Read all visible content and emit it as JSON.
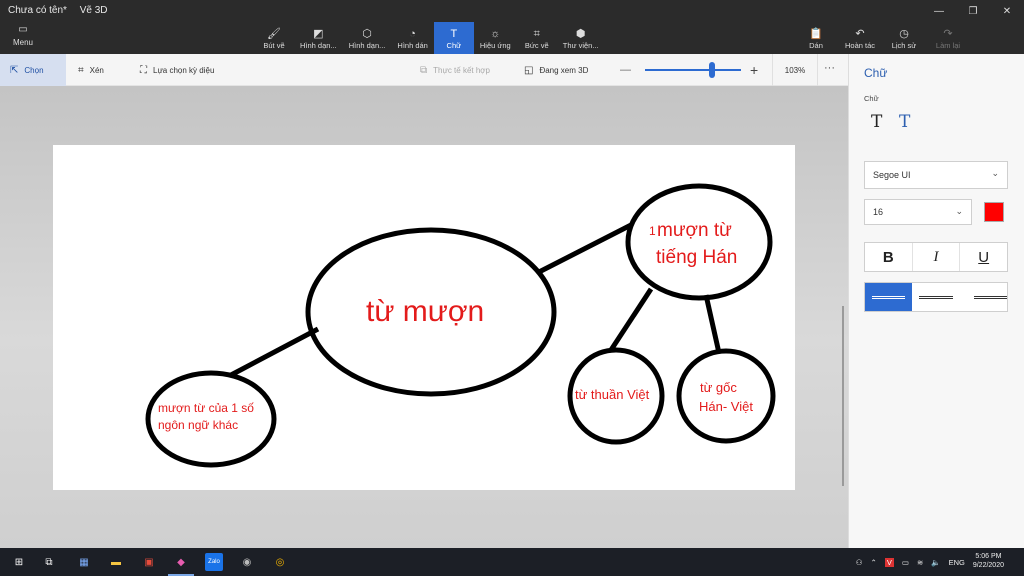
{
  "window": {
    "doc_title": "Chưa có tên*",
    "app_name": "Vẽ 3D"
  },
  "menu": {
    "label": "Menu"
  },
  "ribbon": {
    "tabs": [
      {
        "label": "Bút vẽ",
        "icon": "brush-icon"
      },
      {
        "label": "Hình dạn...",
        "icon": "2d-shapes-icon"
      },
      {
        "label": "Hình dạn...",
        "icon": "3d-shapes-icon"
      },
      {
        "label": "Hình dán",
        "icon": "stickers-icon"
      },
      {
        "label": "Chữ",
        "icon": "text-icon"
      },
      {
        "label": "Hiệu ứng",
        "icon": "effects-icon"
      },
      {
        "label": "Bức vẽ",
        "icon": "canvas-icon"
      },
      {
        "label": "Thư viện...",
        "icon": "library-icon"
      }
    ],
    "active_tab": "Chữ"
  },
  "actions": {
    "paste": "Dán",
    "undo": "Hoàn tác",
    "history": "Lịch sử",
    "redo": "Làm lại"
  },
  "toolbar": {
    "select": "Chọn",
    "crop": "Xén",
    "magic_select": "Lựa chọn kỳ diệu",
    "mixed_reality": "Thực tế kết hợp",
    "view_3d": "Đang xem 3D",
    "zoom": "103%",
    "zoom_level": 0.7
  },
  "canvas": {
    "center_label": "từ mượn",
    "top_right_label_1": "mượn từ",
    "top_right_label_2": "tiếng Hán",
    "stray_mark": "1",
    "left_label_1": "mượn từ của 1 số",
    "left_label_2": "ngôn ngữ khác",
    "bottom_mid_label": "từ thuần Việt",
    "bottom_right_label_1": "từ gốc",
    "bottom_right_label_2": "Hán- Việt",
    "text_color": "#e31b1b"
  },
  "panel": {
    "title": "Chữ",
    "type_label": "Chữ",
    "font": "Segoe UI",
    "size": "16",
    "color": "#ff0000",
    "bold": "B",
    "italic": "I",
    "underline": "U"
  },
  "taskbar": {
    "lang": "ENG",
    "time": "5:06 PM",
    "date": "9/22/2020"
  },
  "colors": {
    "accent": "#2d6bd1",
    "ribbon_bg": "#2b2b2b",
    "taskbar_bg": "#1c1f26"
  }
}
